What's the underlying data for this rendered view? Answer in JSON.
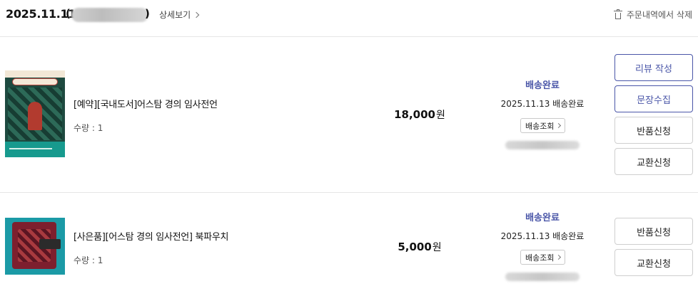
{
  "order": {
    "date": "2025.11.11",
    "number_prefix": "(",
    "number_suffix": ")",
    "detail_link": "상세보기",
    "delete_label": "주문내역에서 삭제"
  },
  "items": [
    {
      "title": "[예약][국내도서]어스탐 경의 임사전언",
      "quantity": "수량 : 1",
      "price": "18,000",
      "currency": "원",
      "status": "배송완료",
      "ship_date": "2025.11.13 배송완료",
      "track_label": "배송조회",
      "actions": [
        "리뷰 작성",
        "문장수집",
        "반품신청",
        "교환신청"
      ]
    },
    {
      "title": "[사은품][어스탐 경의 임사전언] 북파우치",
      "quantity": "수량 : 1",
      "price": "5,000",
      "currency": "원",
      "status": "배송완료",
      "ship_date": "2025.11.13 배송완료",
      "track_label": "배송조회",
      "actions": [
        "반품신청",
        "교환신청"
      ]
    }
  ],
  "colors": {
    "accent": "#4a56a8",
    "divider": "#e6e6e6"
  }
}
